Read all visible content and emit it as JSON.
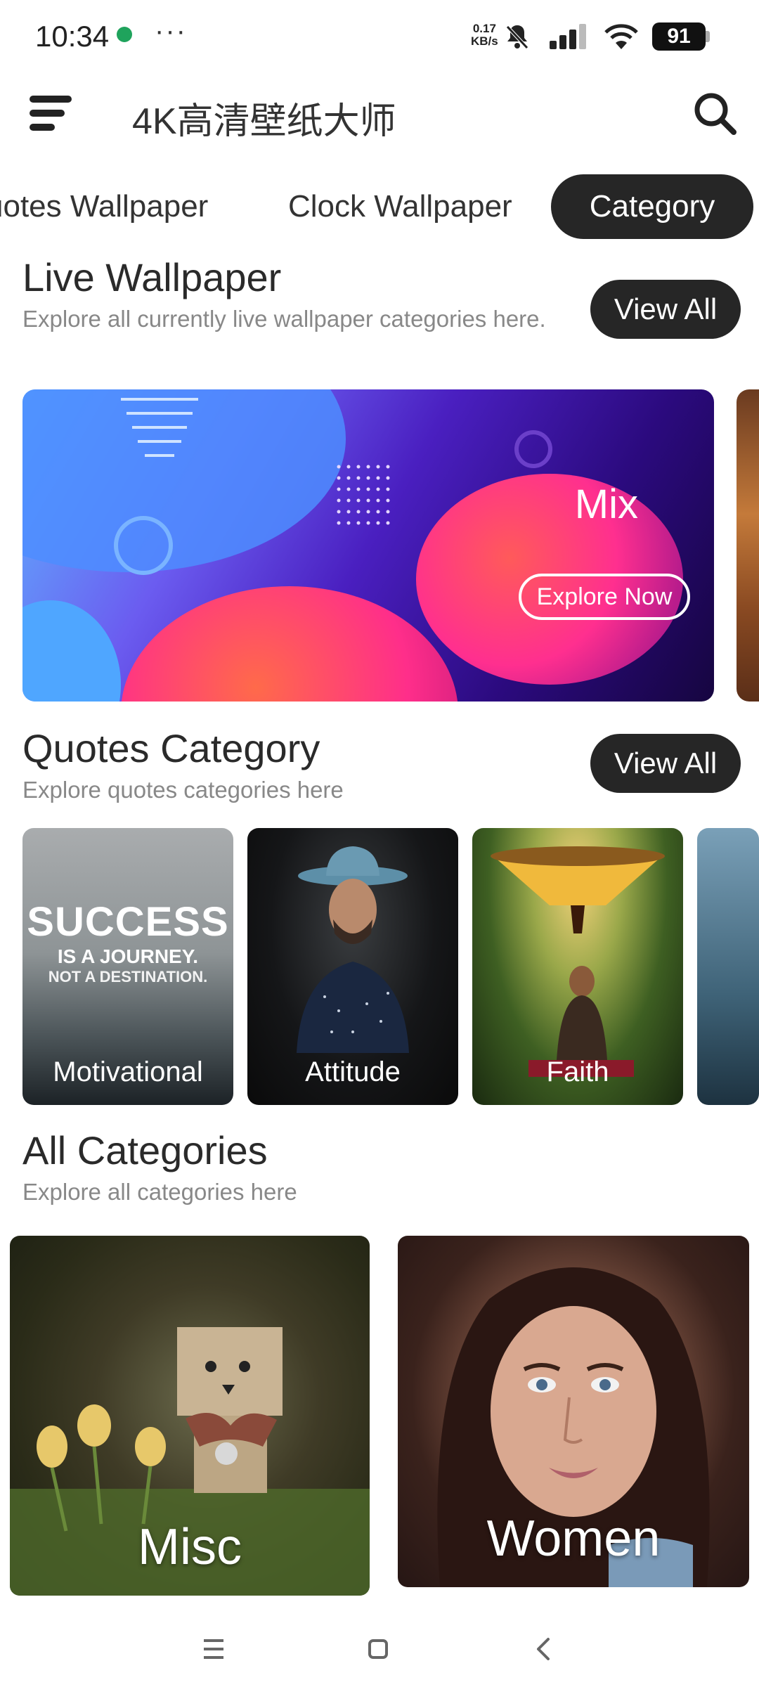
{
  "status_bar": {
    "time": "10:34",
    "more": "···",
    "net_speed_value": "0.17",
    "net_speed_unit": "KB/s",
    "battery": "91"
  },
  "header": {
    "title": "4K高清壁纸大师",
    "menu_icon": "menu-icon",
    "search_icon": "search-icon"
  },
  "tabs": [
    {
      "label": "uotes Wallpaper",
      "active": false
    },
    {
      "label": "Clock Wallpaper",
      "active": false
    },
    {
      "label": "Category",
      "active": true
    }
  ],
  "live_wallpaper": {
    "title": "Live Wallpaper",
    "subtitle": "Explore all currently live wallpaper categories here.",
    "view_all": "View All",
    "banner": {
      "label": "Mix",
      "button": "Explore Now"
    }
  },
  "quotes_category": {
    "title": "Quotes Category",
    "subtitle": "Explore quotes categories here",
    "view_all": "View All",
    "items": [
      {
        "label": "Motivational",
        "image_text": [
          "SUCCESS",
          "IS A JOURNEY.",
          "NOT A DESTINATION."
        ]
      },
      {
        "label": "Attitude"
      },
      {
        "label": "Faith"
      }
    ]
  },
  "all_categories": {
    "title": "All Categories",
    "subtitle": "Explore all categories here",
    "items": [
      {
        "label": "Misc"
      },
      {
        "label": "Women"
      }
    ]
  },
  "colors": {
    "accent_dark": "#262626",
    "subtitle_gray": "#888888"
  }
}
